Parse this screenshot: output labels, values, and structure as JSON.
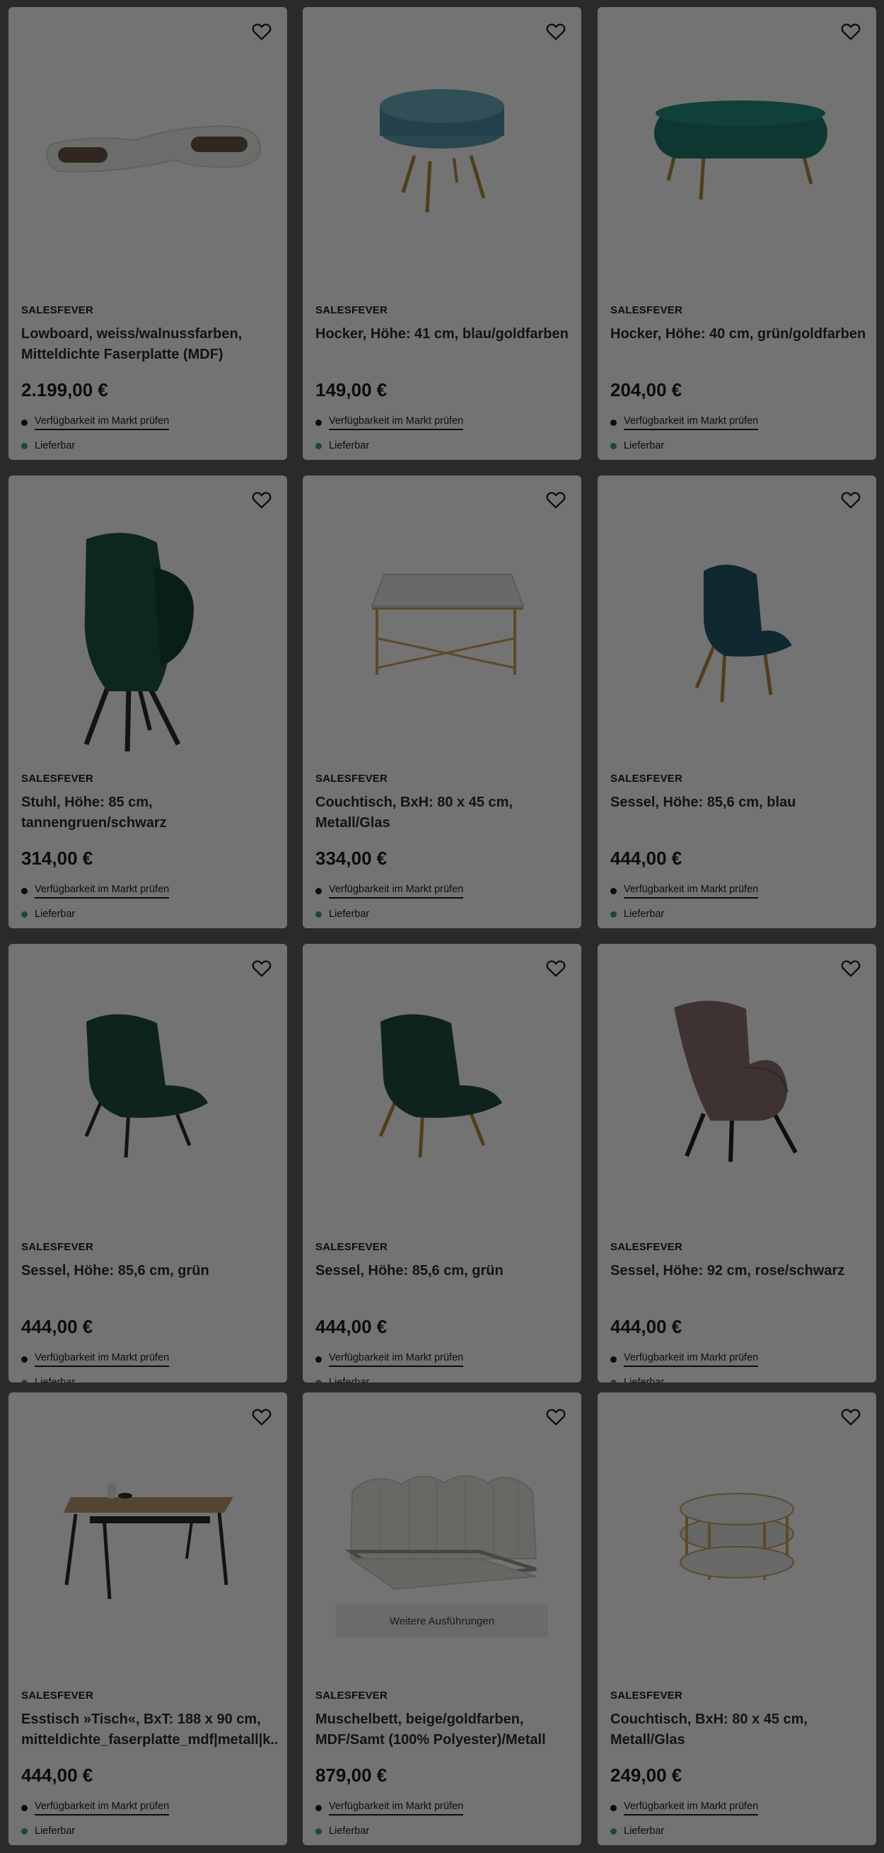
{
  "labels": {
    "availability_link": "Verfügbarkeit im Markt prüfen",
    "delivery": "Lieferbar",
    "more_variants": "Weitere Ausführungen"
  },
  "colors": {
    "overlay": "rgba(0,0,0,0.55)",
    "delivery_dot": "#3aa46a"
  },
  "products": [
    {
      "brand": "SALESFEVER",
      "title": "Lowboard, weiss/walnussfarben, Mitteldichte Faserplatte (MDF)",
      "price": "2.199,00 €",
      "image": "lowboard"
    },
    {
      "brand": "SALESFEVER",
      "title": "Hocker, Höhe: 41 cm, blau/goldfarben",
      "price": "149,00 €",
      "image": "hocker-blue"
    },
    {
      "brand": "SALESFEVER",
      "title": "Hocker, Höhe: 40 cm, grün/goldfarben",
      "price": "204,00 €",
      "image": "bench-green"
    },
    {
      "brand": "SALESFEVER",
      "title": "Stuhl, Höhe: 85 cm, tannengruen/schwarz",
      "price": "314,00 €",
      "image": "chair-green"
    },
    {
      "brand": "SALESFEVER",
      "title": "Couchtisch, BxH: 80 x 45 cm, Metall/Glas",
      "price": "334,00 €",
      "image": "coffee-table-square"
    },
    {
      "brand": "SALESFEVER",
      "title": "Sessel, Höhe: 85,6 cm, blau",
      "price": "444,00 €",
      "image": "armchair-blue"
    },
    {
      "brand": "SALESFEVER",
      "title": "Sessel, Höhe: 85,6 cm, grün",
      "price": "444,00 €",
      "image": "armchair-green-black"
    },
    {
      "brand": "SALESFEVER",
      "title": "Sessel, Höhe: 85,6 cm, grün",
      "price": "444,00 €",
      "image": "armchair-green-gold"
    },
    {
      "brand": "SALESFEVER",
      "title": "Sessel, Höhe: 92 cm, rose/schwarz",
      "price": "444,00 €",
      "image": "wingchair-rose"
    },
    {
      "brand": "SALESFEVER",
      "title": "Esstisch »Tisch«, BxT: 188 x 90 cm, mitteldichte_faserplatte_mdf|metall|k...",
      "price": "444,00 €",
      "image": "dining-table"
    },
    {
      "brand": "SALESFEVER",
      "title": "Muschelbett, beige/goldfarben, MDF/Samt (100% Polyester)/Metall",
      "price": "879,00 €",
      "image": "bed",
      "has_variants": true
    },
    {
      "brand": "SALESFEVER",
      "title": "Couchtisch, BxH: 80 x 45 cm, Metall/Glas",
      "price": "249,00 €",
      "image": "coffee-table-round"
    }
  ]
}
